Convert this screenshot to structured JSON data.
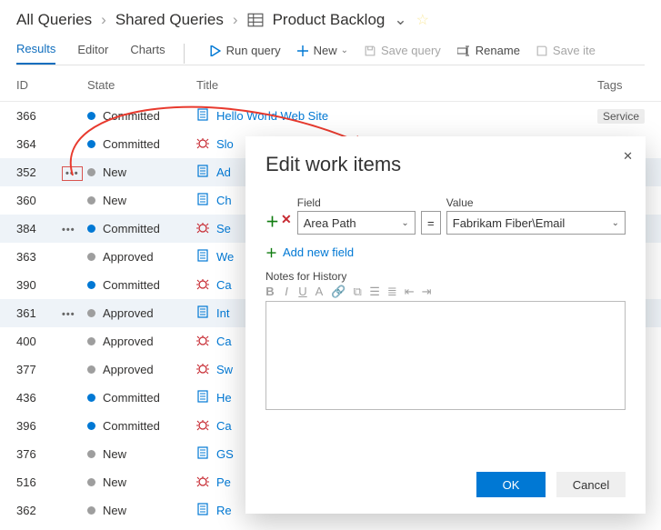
{
  "breadcrumb": {
    "root": "All Queries",
    "folder": "Shared Queries",
    "query": "Product Backlog"
  },
  "tabs": {
    "results": "Results",
    "editor": "Editor",
    "charts": "Charts"
  },
  "toolbar": {
    "run": "Run query",
    "new": "New",
    "save": "Save query",
    "rename": "Rename",
    "saveas": "Save ite"
  },
  "columns": {
    "id": "ID",
    "state": "State",
    "title": "Title",
    "tags": "Tags"
  },
  "states": {
    "committed": "Committed",
    "new": "New",
    "approved": "Approved"
  },
  "tags": {
    "service": "Service"
  },
  "rows": [
    {
      "id": "366",
      "stateKey": "committed",
      "dot": "blue",
      "bug": false,
      "title": "Hello World Web Site",
      "tag": "service"
    },
    {
      "id": "364",
      "stateKey": "committed",
      "dot": "blue",
      "bug": true,
      "title": "Slo"
    },
    {
      "id": "352",
      "stateKey": "new",
      "dot": "grey",
      "bug": false,
      "title": "Ad",
      "ell": true,
      "ellBoxed": true,
      "sel": true
    },
    {
      "id": "360",
      "stateKey": "new",
      "dot": "grey",
      "bug": false,
      "title": "Ch"
    },
    {
      "id": "384",
      "stateKey": "committed",
      "dot": "blue",
      "bug": true,
      "title": "Se",
      "ell": true,
      "sel": true
    },
    {
      "id": "363",
      "stateKey": "approved",
      "dot": "grey",
      "bug": false,
      "title": "We"
    },
    {
      "id": "390",
      "stateKey": "committed",
      "dot": "blue",
      "bug": true,
      "title": "Ca"
    },
    {
      "id": "361",
      "stateKey": "approved",
      "dot": "grey",
      "bug": false,
      "title": "Int",
      "ell": true,
      "sel": true
    },
    {
      "id": "400",
      "stateKey": "approved",
      "dot": "grey",
      "bug": true,
      "title": "Ca"
    },
    {
      "id": "377",
      "stateKey": "approved",
      "dot": "grey",
      "bug": true,
      "title": "Sw"
    },
    {
      "id": "436",
      "stateKey": "committed",
      "dot": "blue",
      "bug": false,
      "title": "He"
    },
    {
      "id": "396",
      "stateKey": "committed",
      "dot": "blue",
      "bug": true,
      "title": "Ca"
    },
    {
      "id": "376",
      "stateKey": "new",
      "dot": "grey",
      "bug": false,
      "title": "GS"
    },
    {
      "id": "516",
      "stateKey": "new",
      "dot": "grey",
      "bug": true,
      "title": "Pe"
    },
    {
      "id": "362",
      "stateKey": "new",
      "dot": "grey",
      "bug": false,
      "title": "Re"
    }
  ],
  "modal": {
    "title": "Edit work items",
    "fieldLabel": "Field",
    "valueLabel": "Value",
    "fieldValue": "Area Path",
    "op": "=",
    "value": "Fabrikam Fiber\\Email",
    "addNew": "Add new field",
    "notesLabel": "Notes for History",
    "ok": "OK",
    "cancel": "Cancel"
  },
  "rte": [
    "B",
    "I",
    "U",
    "A",
    "🔗",
    "⧉",
    "☰",
    "≣",
    "⇤",
    "⇥"
  ]
}
